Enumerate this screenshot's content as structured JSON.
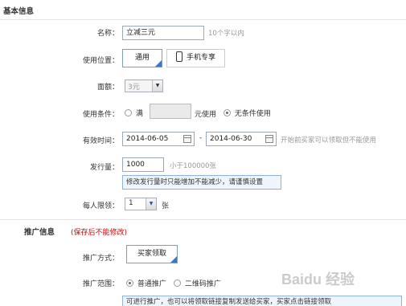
{
  "basic_info": {
    "section_title": "基本信息",
    "name": {
      "label": "名称：",
      "value": "立减三元",
      "hint": "10个字以内"
    },
    "usage_location": {
      "label": "使用位置：",
      "options": [
        "通用",
        "手机专享"
      ],
      "selected": "通用"
    },
    "denomination": {
      "label": "面额：",
      "value": "3元"
    },
    "usage_condition": {
      "label": "使用条件：",
      "option_full": "满",
      "suffix": "元使用",
      "option_none": "无条件使用",
      "selected": "无条件使用"
    },
    "valid_period": {
      "label": "有效时间：",
      "start": "2014-06-05",
      "separator": "-",
      "end": "2014-06-30",
      "hint": "开始前买家可以领取但不能使用"
    },
    "issue_quantity": {
      "label": "发行量：",
      "value": "1000",
      "hint": "小于100000张",
      "tip": "修改发行量时只能增加不能减少，请谨慎设置"
    },
    "per_person_limit": {
      "label": "每人限领：",
      "value": "1",
      "unit": "张"
    }
  },
  "promo_info": {
    "section_title": "推广信息",
    "note": "(保存后不能修改)",
    "promo_method": {
      "label": "推广方式：",
      "value": "买家领取"
    },
    "promo_scope": {
      "label": "推广范围：",
      "options": [
        "普通推广",
        "二维码推广"
      ],
      "selected": "普通推广"
    },
    "tip": "可进行推广，也可以将领取链接复制发送给买家，买家点击链接领取"
  },
  "watermark": "Baidu 经验"
}
